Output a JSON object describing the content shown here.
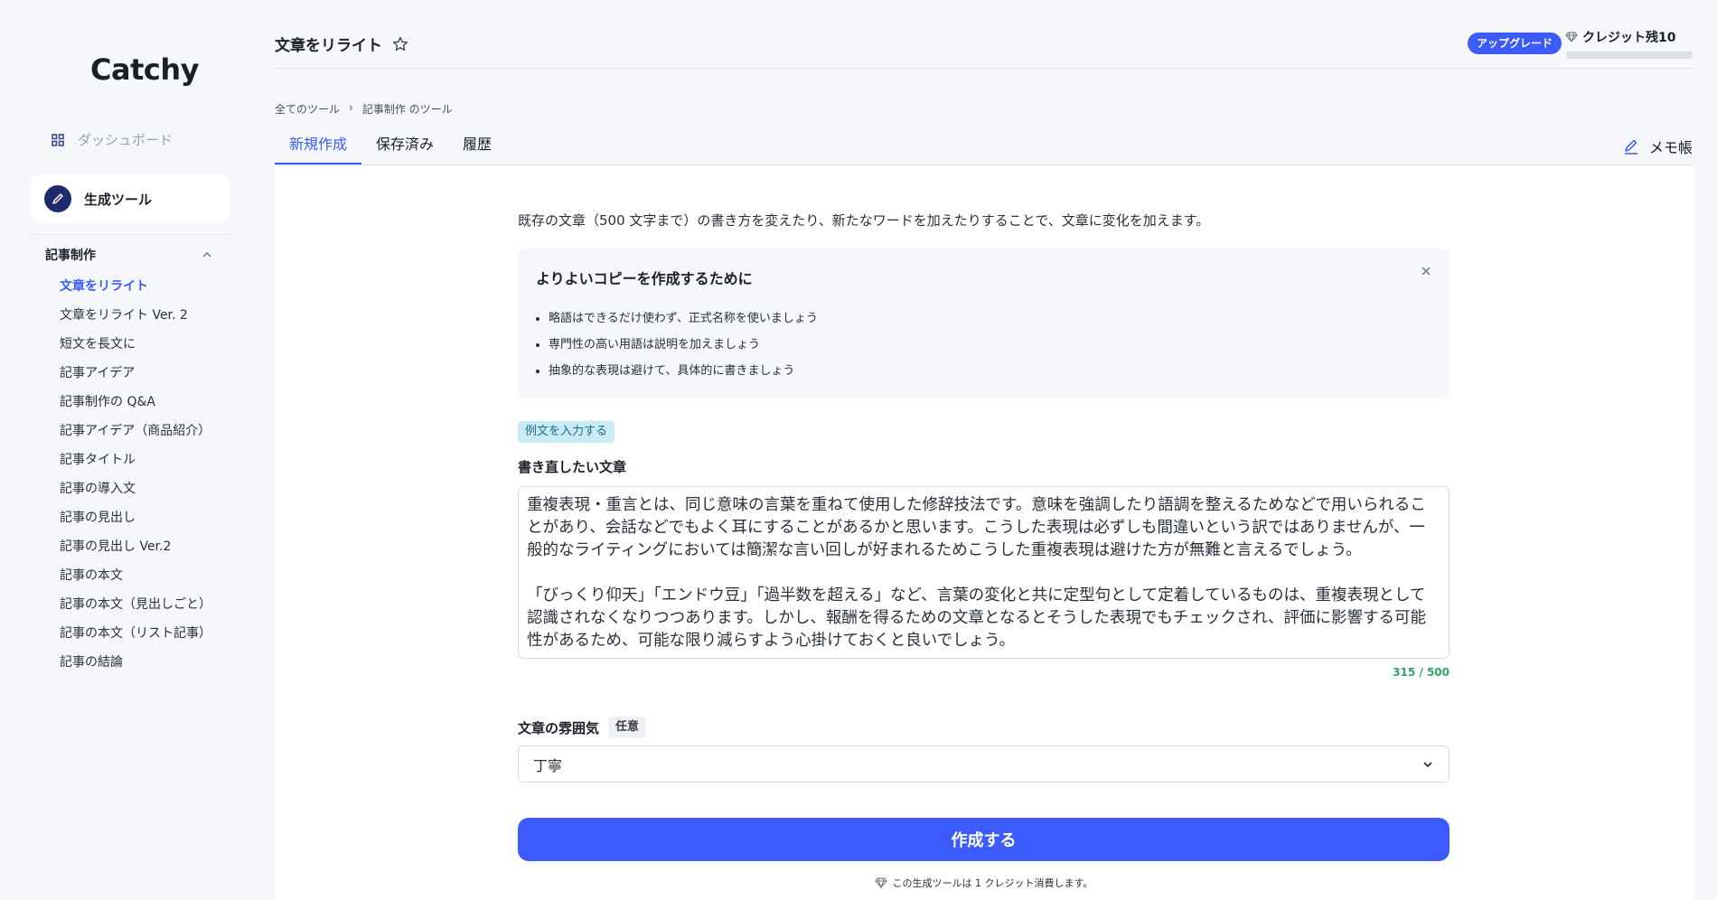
{
  "sidebar": {
    "logo": "Catchy",
    "dashboard": {
      "label": "ダッシュボード",
      "icon": "grid-icon"
    },
    "gen_tools": {
      "label": "生成ツール",
      "icon": "pen-icon"
    },
    "section": {
      "title": "記事制作",
      "icon": "chevron-up-icon"
    },
    "items": [
      {
        "label": "文章をリライト",
        "active": true
      },
      {
        "label": "文章をリライト Ver. 2"
      },
      {
        "label": "短文を長文に"
      },
      {
        "label": "記事アイデア"
      },
      {
        "label": "記事制作の Q&A"
      },
      {
        "label": "記事アイデア（商品紹介）"
      },
      {
        "label": "記事タイトル"
      },
      {
        "label": "記事の導入文"
      },
      {
        "label": "記事の見出し"
      },
      {
        "label": "記事の見出し Ver.2"
      },
      {
        "label": "記事の本文"
      },
      {
        "label": "記事の本文（見出しごと）"
      },
      {
        "label": "記事の本文（リスト記事）"
      },
      {
        "label": "記事の結論"
      }
    ]
  },
  "header": {
    "title": "文章をリライト",
    "upgrade": "アップグレード",
    "credits": "クレジット残10"
  },
  "breadcrumb": {
    "root": "全てのツール",
    "separator": "›",
    "current": "記事制作 のツール"
  },
  "tabs": [
    {
      "label": "新規作成",
      "active": true
    },
    {
      "label": "保存済み"
    },
    {
      "label": "履歴"
    }
  ],
  "memo": {
    "label": "メモ帳",
    "icon": "edit-icon"
  },
  "main": {
    "description": "既存の文章（500 文字まで）の書き方を変えたり、新たなワードを加えたりすることで、文章に変化を加えます。",
    "tips": {
      "title": "よりよいコピーを作成するために",
      "items": [
        "略語はできるだけ使わず、正式名称を使いましょう",
        "専門性の高い用語は説明を加えましょう",
        "抽象的な表現は避けて、具体的に書きましょう"
      ]
    },
    "example_button": "例文を入力する",
    "rewrite_label": "書き直したい文章",
    "rewrite_text": "重複表現・重言とは、同じ意味の言葉を重ねて使用した修辞技法です。意味を強調したり語調を整えるためなどで用いられることがあり、会話などでもよく耳にすることがあるかと思います。こうした表現は必ずしも間違いという訳ではありませんが、一般的なライティングにおいては簡潔な言い回しが好まれるためこうした重複表現は避けた方が無難と言えるでしょう。\n\n「びっくり仰天」「エンドウ豆」「過半数を超える」など、言葉の変化と共に定型句として定着しているものは、重複表現として認識されなくなりつつあります。しかし、報酬を得るための文章となるとそうした表現でもチェックされ、評価に影響する可能性があるため、可能な限り減らすよう心掛けておくと良いでしょう。",
    "char_count": "315 / 500",
    "mood_label": "文章の雰囲気",
    "optional": "任意",
    "mood_value": "丁寧",
    "submit": "作成する",
    "footnote": "この生成ツールは 1 クレジット消費します。"
  },
  "colors": {
    "accent": "#3b5bfd",
    "count_ok": "#2fa36b",
    "example_bg": "#c9ebf8"
  }
}
